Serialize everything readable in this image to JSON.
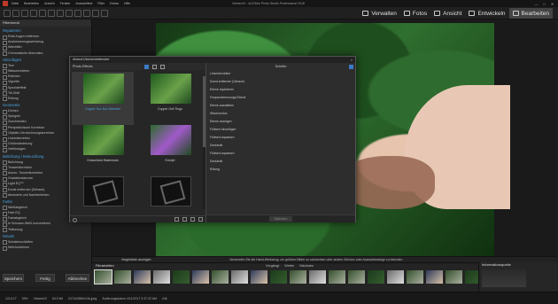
{
  "window": {
    "title": "ViewerAX - ACDSee Photo Studio Professional 2018",
    "menu": [
      "Datei",
      "Bearbeiten",
      "Ansicht",
      "Fenster",
      "Auswahltext",
      "Filter",
      "Extras",
      "Hilfe"
    ],
    "controls": [
      "—",
      "□",
      "✕"
    ]
  },
  "modes": [
    {
      "label": "Verwalten",
      "active": false
    },
    {
      "label": "Fotos",
      "active": false
    },
    {
      "label": "Ansicht",
      "active": false
    },
    {
      "label": "Entwickeln",
      "active": false
    },
    {
      "label": "Bearbeiten",
      "active": true
    }
  ],
  "left_panel": {
    "title": "Filtermenü",
    "groups": [
      {
        "name": "Reparieren",
        "tools": [
          "Rote Augen entfernen",
          "Ausbesserungswerkzeug",
          "Weichfilm",
          "Chromatische Aberration"
        ]
      },
      {
        "name": "Hinzufügen",
        "tools": [
          "Text",
          "Wasserzeichen",
          "Rahmen",
          "Vignette",
          "Spezialeffekt",
          "Tilt-Shift",
          "Rötung"
        ]
      },
      {
        "name": "Geometrie",
        "tools": [
          "Drehen",
          "Spiegeln",
          "Zuschneiden",
          "Perspektivische Korrektur",
          "Objektiv-Verzeichnungskorrektur",
          "Linsenkorrektur",
          "Größenänderung",
          "Verflüssigen"
        ]
      },
      {
        "name": "Belichtung / Beleuchtung",
        "tools": [
          "Belichtung",
          "Tonwertkorrektur",
          "Autom. Tonwertkorrektur",
          "Gradationskurven",
          "Light EQ™",
          "Dunst entfernen (Dehaze)",
          "Abwedeln und Nachbelichten"
        ]
      },
      {
        "name": "Farbe",
        "tools": [
          "Weißabgleich",
          "Farb EQ",
          "Farbabgleich",
          "In Schwarz-Weiß konvertieren",
          "Teiltonung"
        ]
      },
      {
        "name": "Details",
        "tools": [
          "Schattenschärfen",
          "Weichzeichnen"
        ]
      }
    ],
    "save_label": "Speichern",
    "done_label": "Fertig",
    "cancel_label": "Abbrechen"
  },
  "dialog": {
    "title": "Ablauf-Übersichtsfenster",
    "effects_header": "Photo Effects",
    "steps_header": "Schritte",
    "effects": [
      {
        "label": "Copper Sun Not Selected",
        "style": "normal",
        "selected": true
      },
      {
        "label": "Copper Owl Tingo",
        "style": "normal",
        "selected": false
      },
      {
        "label": "Outworlded Watermark",
        "style": "normal",
        "selected": false
      },
      {
        "label": "Everjet",
        "style": "purple",
        "selected": false
      },
      {
        "label": "",
        "style": "frame",
        "selected": false
      },
      {
        "label": "",
        "style": "frame",
        "selected": false
      }
    ],
    "steps": [
      "Linsenkorrektur",
      "Dunst entfernen (Dehaze)",
      "Ebene duplizieren",
      "Frequenztrennungs-Ebene",
      "Ebene auswählen",
      "Wischmodus",
      "Ebene anzeigen",
      "Füllwert hinzufügen",
      "Füllwert anpassen",
      "Deckkraft",
      "Füllwert anpassen",
      "Deckkraft",
      "Rötung"
    ],
    "save_label": "Speichern"
  },
  "viewer": {
    "compare_label": "Vergleichen anzeigen",
    "hint": "Verwenden Sie die Hand-Werkzeug, um größere Bilder zu schwenken oder andere Zeichen oder Auswahlanzeige zu beenden."
  },
  "filmstrip": {
    "title": "Filmstreifen",
    "nav": [
      "Vorgängt",
      "Weiter",
      "Nächstes"
    ],
    "thumb_count": 20
  },
  "info_panel": {
    "title": "Informationsquelle"
  },
  "status": {
    "items": [
      "121/127",
      "39%",
      "ViewerAX",
      "54.5 kB",
      "2472x2589x24b.jpeg",
      "Änderungsdatum 4/11/2017 3:37:22 AM",
      "24k"
    ]
  }
}
